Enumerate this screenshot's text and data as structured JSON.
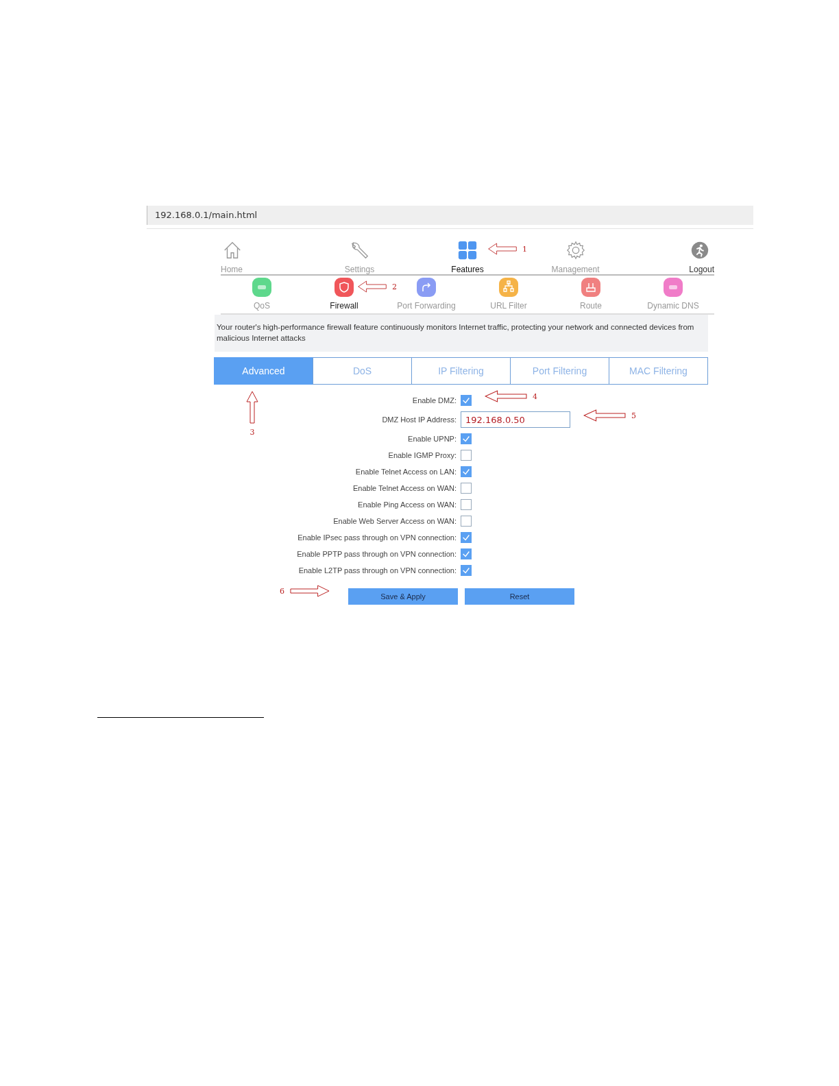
{
  "address_bar": {
    "url": "192.168.0.1/main.html"
  },
  "main_nav": [
    {
      "label": "Home",
      "selected": false,
      "kind": "page"
    },
    {
      "label": "Settings",
      "selected": false,
      "kind": "page"
    },
    {
      "label": "Features",
      "selected": true,
      "kind": "page"
    },
    {
      "label": "Management",
      "selected": false,
      "kind": "page"
    },
    {
      "label": "Logout",
      "selected": false,
      "kind": "action"
    }
  ],
  "feature_nav": [
    {
      "label": "QoS",
      "selected": false,
      "color": "#5ed88c"
    },
    {
      "label": "Firewall",
      "selected": true,
      "color": "#f0565a"
    },
    {
      "label": "Port Forwarding",
      "selected": false,
      "color": "#8a9cf4"
    },
    {
      "label": "URL Filter",
      "selected": false,
      "color": "#f5b347"
    },
    {
      "label": "Route",
      "selected": false,
      "color": "#f08080"
    },
    {
      "label": "Dynamic DNS",
      "selected": false,
      "color": "#f07cc8"
    }
  ],
  "description": "Your router's high-performance firewall feature continuously monitors Internet traffic, protecting your network and connected devices from malicious Internet attacks",
  "tabs": [
    {
      "label": "Advanced",
      "selected": true
    },
    {
      "label": "DoS",
      "selected": false
    },
    {
      "label": "IP Filtering",
      "selected": false
    },
    {
      "label": "Port Filtering",
      "selected": false
    },
    {
      "label": "MAC Filtering",
      "selected": false
    }
  ],
  "settings": [
    {
      "kind": "checkbox",
      "label": "Enable DMZ:",
      "checked": true
    },
    {
      "kind": "text",
      "label": "DMZ Host IP Address:",
      "value": "192.168.0.50"
    },
    {
      "kind": "checkbox",
      "label": "Enable UPNP:",
      "checked": true
    },
    {
      "kind": "checkbox",
      "label": "Enable IGMP Proxy:",
      "checked": false
    },
    {
      "kind": "checkbox",
      "label": "Enable Telnet Access on LAN:",
      "checked": true
    },
    {
      "kind": "checkbox",
      "label": "Enable Telnet Access on WAN:",
      "checked": false
    },
    {
      "kind": "checkbox",
      "label": "Enable Ping Access on WAN:",
      "checked": false
    },
    {
      "kind": "checkbox",
      "label": "Enable Web Server Access on WAN:",
      "checked": false
    },
    {
      "kind": "checkbox",
      "label": "Enable IPsec pass through on VPN connection:",
      "checked": true
    },
    {
      "kind": "checkbox",
      "label": "Enable PPTP pass through on VPN connection:",
      "checked": true
    },
    {
      "kind": "checkbox",
      "label": "Enable L2TP pass through on VPN connection:",
      "checked": true
    }
  ],
  "buttons": [
    "Save & Apply",
    "Reset"
  ],
  "annotations": [
    {
      "label": "1",
      "kind": "left"
    },
    {
      "label": "2",
      "kind": "left"
    },
    {
      "label": "3",
      "kind": "up"
    },
    {
      "label": "4",
      "kind": "left"
    },
    {
      "label": "5",
      "kind": "left"
    },
    {
      "label": "6",
      "kind": "right"
    }
  ]
}
